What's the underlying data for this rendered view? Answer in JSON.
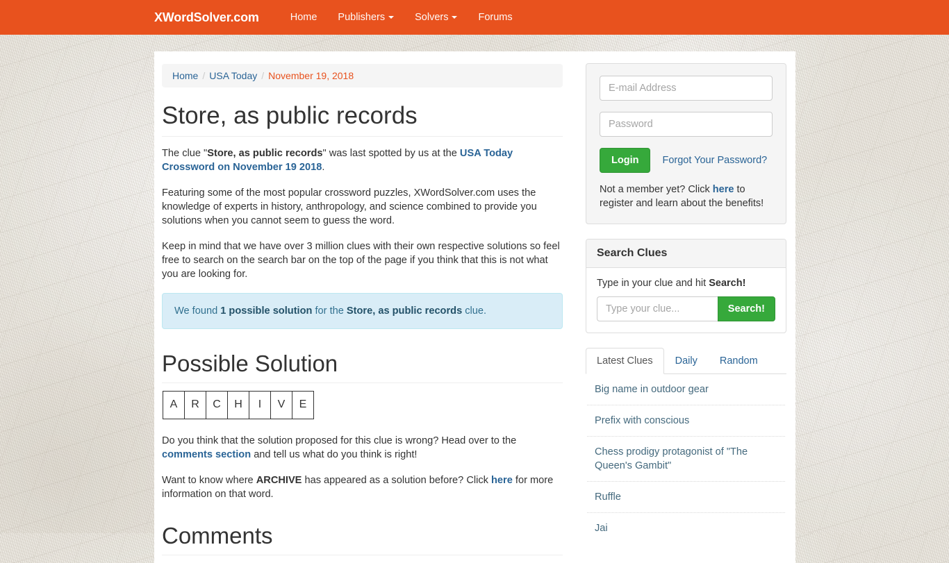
{
  "navbar": {
    "brand": "XWordSolver.com",
    "links": [
      {
        "label": "Home",
        "caret": false
      },
      {
        "label": "Publishers",
        "caret": true
      },
      {
        "label": "Solvers",
        "caret": true
      },
      {
        "label": "Forums",
        "caret": false
      }
    ],
    "bg_color": "#e8521e"
  },
  "breadcrumb": {
    "home": "Home",
    "publisher": "USA Today",
    "date": "November 19, 2018",
    "separator": "/"
  },
  "main": {
    "title": "Store, as public records",
    "para1": {
      "pre": "The clue \"",
      "clue": "Store, as public records",
      "mid": "\" was last spotted by us at the ",
      "link": "USA Today Crossword on November 19 2018",
      "post": "."
    },
    "para2": "Featuring some of the most popular crossword puzzles, XWordSolver.com uses the knowledge of experts in history, anthropology, and science combined to provide you solutions when you cannot seem to guess the word.",
    "para3": "Keep in mind that we have over 3 million clues with their own respective solutions so feel free to search on the search bar on the top of the page if you think that this is not what you are looking for.",
    "alert": {
      "pre": "We found ",
      "count": "1 possible solution",
      "mid": " for the ",
      "clue": "Store, as public records",
      "post": " clue."
    },
    "solution_heading": "Possible Solution",
    "solution_word": "ARCHIVE",
    "solution_letters": [
      "A",
      "R",
      "C",
      "H",
      "I",
      "V",
      "E"
    ],
    "para4": {
      "pre": "Do you think that the solution proposed for this clue is wrong? Head over to the ",
      "link": "comments section",
      "post": " and tell us what do you think is right!"
    },
    "para5": {
      "pre": "Want to know where ",
      "word": "ARCHIVE",
      "mid": " has appeared as a solution before? Click ",
      "link": "here",
      "post": " for more information on that word."
    },
    "comments_heading": "Comments"
  },
  "sidebar": {
    "login": {
      "email_placeholder": "E-mail Address",
      "email_value": "",
      "password_placeholder": "Password",
      "password_value": "",
      "login_label": "Login",
      "forgot_label": "Forgot Your Password?",
      "member_pre": "Not a member yet? Click ",
      "member_link": "here",
      "member_post": " to register and learn about the benefits!",
      "button_color": "#36a93b"
    },
    "search": {
      "panel_title": "Search Clues",
      "hint_pre": "Type in your clue and hit ",
      "hint_bold": "Search!",
      "input_placeholder": "Type your clue...",
      "input_value": "",
      "button_label": "Search!"
    },
    "tabs": [
      {
        "label": "Latest Clues",
        "active": true
      },
      {
        "label": "Daily",
        "active": false
      },
      {
        "label": "Random",
        "active": false
      }
    ],
    "clues": [
      "Big name in outdoor gear",
      "Prefix with conscious",
      "Chess prodigy protagonist of \"The Queen's Gambit\"",
      "Ruffle",
      "Jai"
    ]
  }
}
